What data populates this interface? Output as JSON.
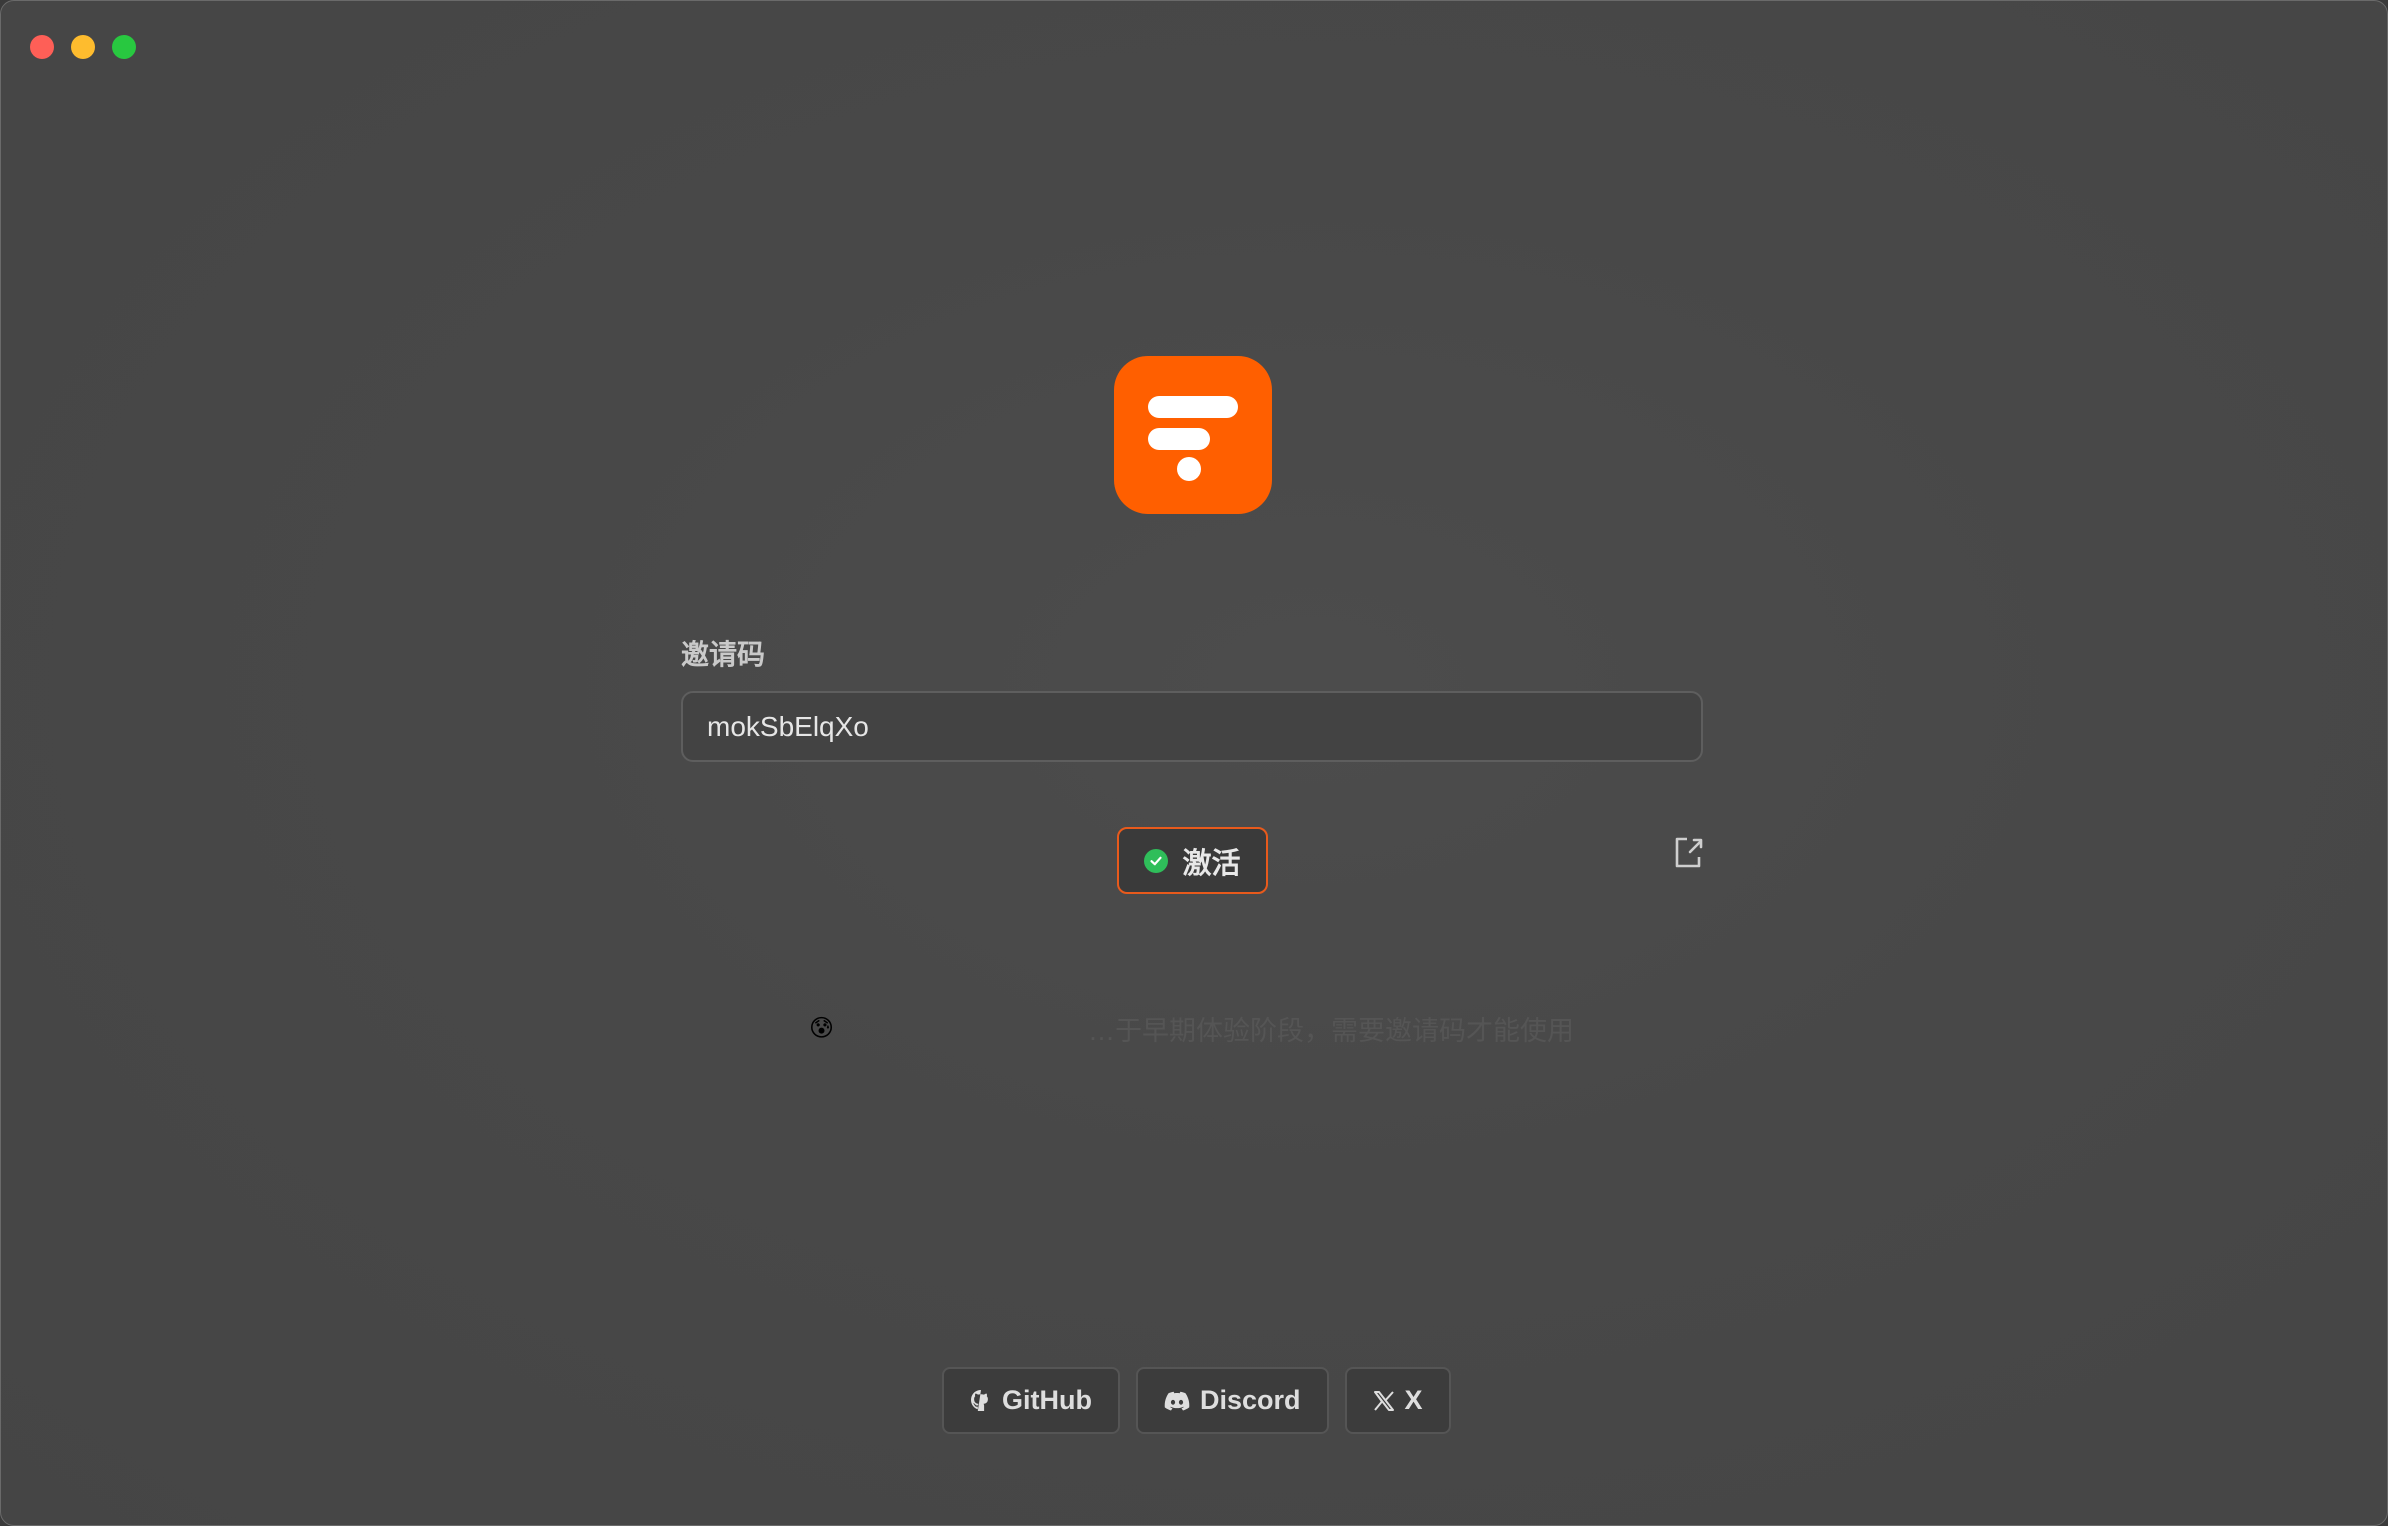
{
  "window": {
    "controls": [
      "close",
      "minimize",
      "maximize"
    ]
  },
  "logo": {
    "icon": "app-logo",
    "color": "#ff5f00"
  },
  "invite": {
    "label": "邀请码",
    "value": "mokSbElqXo"
  },
  "activate": {
    "label": "激活",
    "status_icon": "check-circle-icon",
    "border_color": "#e85a1c"
  },
  "export": {
    "icon": "export-icon"
  },
  "notice": {
    "emoji": "😰",
    "text": "…于早期体验阶段，需要邀请码才能使用"
  },
  "links": [
    {
      "label": "GitHub",
      "icon": "github-icon"
    },
    {
      "label": "Discord",
      "icon": "discord-icon"
    },
    {
      "label": "X",
      "icon": "x-logo-icon"
    }
  ]
}
